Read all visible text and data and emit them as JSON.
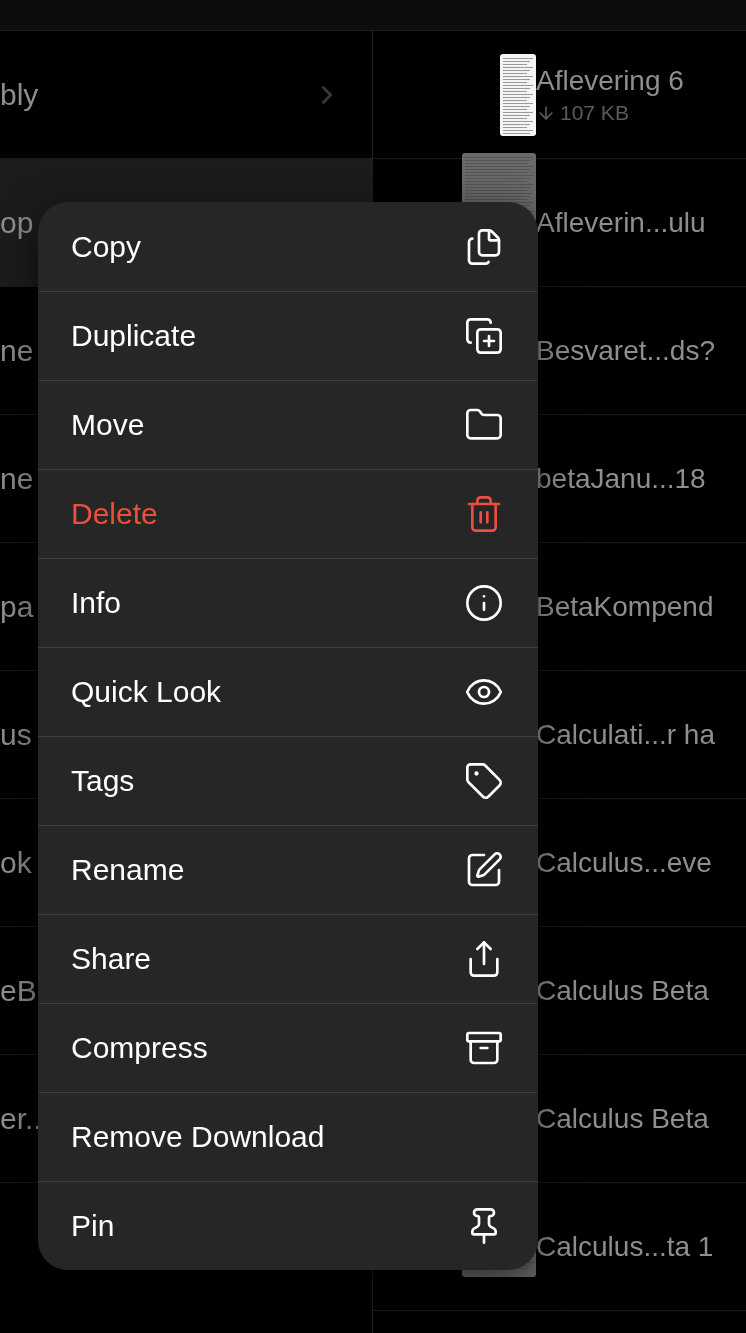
{
  "folder_list": {
    "items": [
      {
        "label": "bly",
        "kind": "folder",
        "selected": false
      },
      {
        "label": "op",
        "kind": "file",
        "selected": true
      },
      {
        "label": "ne",
        "kind": "file",
        "selected": false
      },
      {
        "label": "ne",
        "kind": "file",
        "selected": false
      },
      {
        "label": "pa",
        "kind": "file",
        "selected": false
      },
      {
        "label": "us",
        "kind": "file",
        "selected": false
      },
      {
        "label": "ok",
        "kind": "file",
        "selected": false
      },
      {
        "label": "eB",
        "kind": "file",
        "selected": false
      },
      {
        "label": "er..",
        "kind": "file",
        "selected": false
      }
    ]
  },
  "file_list": {
    "items": [
      {
        "title": "Aflevering 6",
        "size": "107 KB",
        "faded": false
      },
      {
        "title": "Afleverin...ulu",
        "faded": true
      },
      {
        "title": "Besvaret...ds?"
      },
      {
        "title": "betaJanu...18"
      },
      {
        "title": "BetaKompend"
      },
      {
        "title": "Calculati...r ha"
      },
      {
        "title": "Calculus...eve"
      },
      {
        "title": "Calculus Beta"
      },
      {
        "title": "Calculus Beta"
      },
      {
        "title": "Calculus...ta 1",
        "faded": true
      }
    ]
  },
  "context_menu": {
    "items": [
      {
        "label": "Copy",
        "kind": "copy",
        "destructive": false
      },
      {
        "label": "Duplicate",
        "kind": "duplicate",
        "destructive": false
      },
      {
        "label": "Move",
        "kind": "move",
        "destructive": false
      },
      {
        "label": "Delete",
        "kind": "delete",
        "destructive": true
      },
      {
        "label": "Info",
        "kind": "info",
        "destructive": false
      },
      {
        "label": "Quick Look",
        "kind": "quicklook",
        "destructive": false
      },
      {
        "label": "Tags",
        "kind": "tags",
        "destructive": false
      },
      {
        "label": "Rename",
        "kind": "rename",
        "destructive": false
      },
      {
        "label": "Share",
        "kind": "share",
        "destructive": false
      },
      {
        "label": "Compress",
        "kind": "compress",
        "destructive": false
      },
      {
        "label": "Remove Download",
        "kind": "removedownload",
        "destructive": false
      },
      {
        "label": "Pin",
        "kind": "pin",
        "destructive": false
      }
    ]
  }
}
